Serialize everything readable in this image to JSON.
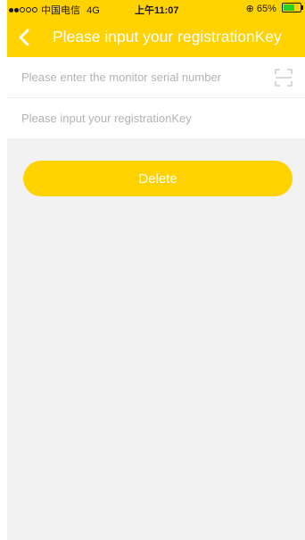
{
  "status_bar": {
    "carrier": "中国电信",
    "network": "4G",
    "time": "上午11:07",
    "battery_percent": "65%",
    "battery_level": 0.65,
    "accent_color": "#ffd200"
  },
  "nav": {
    "back_icon": "chevron-left-icon",
    "title": "Please input your registrationKey"
  },
  "form": {
    "serial_placeholder": "Please enter the monitor serial number",
    "serial_value": "",
    "scan_icon": "scan-icon",
    "key_placeholder": "Please input your registrationKey",
    "key_value": ""
  },
  "actions": {
    "delete_label": "Delete"
  }
}
